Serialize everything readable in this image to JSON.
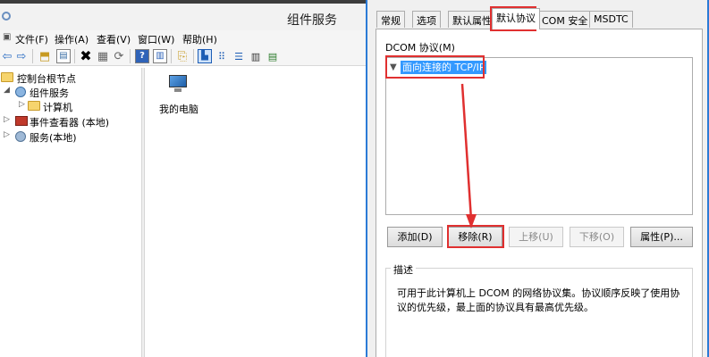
{
  "mmc": {
    "title": "组件服务",
    "menu": [
      "文件(F)",
      "操作(A)",
      "查看(V)",
      "窗口(W)",
      "帮助(H)"
    ],
    "toolbar_icons": [
      "back-icon",
      "forward-icon",
      "up-folder-icon",
      "show-hide-tree-icon",
      "delete-icon",
      "properties-icon",
      "refresh-icon",
      "help-icon",
      "action-pane-icon",
      "new-window-icon",
      "large-icons-view-icon",
      "small-icons-view-icon",
      "list-view-icon",
      "detail-view-icon"
    ],
    "tree": [
      {
        "label": "控制台根节点",
        "icon": "folder-icon",
        "expander": ""
      },
      {
        "label": "组件服务",
        "icon": "component-services-icon",
        "expander": "◢"
      },
      {
        "label": "计算机",
        "icon": "folder-icon",
        "expander": "▷"
      },
      {
        "label": "事件查看器 (本地)",
        "icon": "event-viewer-icon",
        "expander": "▷"
      },
      {
        "label": "服务(本地)",
        "icon": "services-icon",
        "expander": "▷"
      }
    ],
    "content_items": [
      {
        "label": "我的电脑",
        "icon": "my-computer-icon"
      }
    ]
  },
  "dialog": {
    "tabs": [
      "常规",
      "选项",
      "默认属性",
      "默认协议",
      "COM 安全",
      "MSDTC"
    ],
    "active_tab": "默认协议",
    "protocols_label": "DCOM 协议(M)",
    "protocols": [
      {
        "label": "面向连接的 TCP/IP",
        "selected": true
      }
    ],
    "buttons": {
      "add": "添加(D)",
      "remove": "移除(R)",
      "move_up": "上移(U)",
      "move_down": "下移(O)",
      "properties": "属性(P)..."
    },
    "description": {
      "legend": "描述",
      "text": "可用于此计算机上 DCOM 的网络协议集。协议顺序反映了使用协议的优先级，最上面的协议具有最高优先级。"
    }
  },
  "colors": {
    "annotation": "#e03030",
    "selection": "#3399ff",
    "dialog_border": "#2b7bd6"
  }
}
